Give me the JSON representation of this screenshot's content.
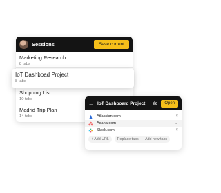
{
  "sessions": {
    "title": "Sessions",
    "save_label": "Save current",
    "items": [
      {
        "name": "Marketing Research",
        "count": "8 tabs"
      },
      {
        "name": "IoT Dashboad Project",
        "count": "8 tabs"
      },
      {
        "name": "Shopping List",
        "count": "10 tabs"
      },
      {
        "name": "Madrid Trip Plan",
        "count": "14 tabs"
      }
    ]
  },
  "detail": {
    "title": "IoT Dashboard Project",
    "open_label": "Open",
    "links": [
      {
        "label": "Atlassian.com",
        "icon": "atlassian-icon",
        "action": "×"
      },
      {
        "label": "Asana.com",
        "icon": "asana-icon",
        "action": "→"
      },
      {
        "label": "Slack.com",
        "icon": "slack-icon",
        "action": "×"
      }
    ],
    "add_url_label": "+ Add URL",
    "replace_tabs_label": "Replace tabs",
    "add_new_tabs_label": "Add new tabs"
  },
  "colors": {
    "accent": "#f5bf1a",
    "header_bg": "#141414"
  }
}
